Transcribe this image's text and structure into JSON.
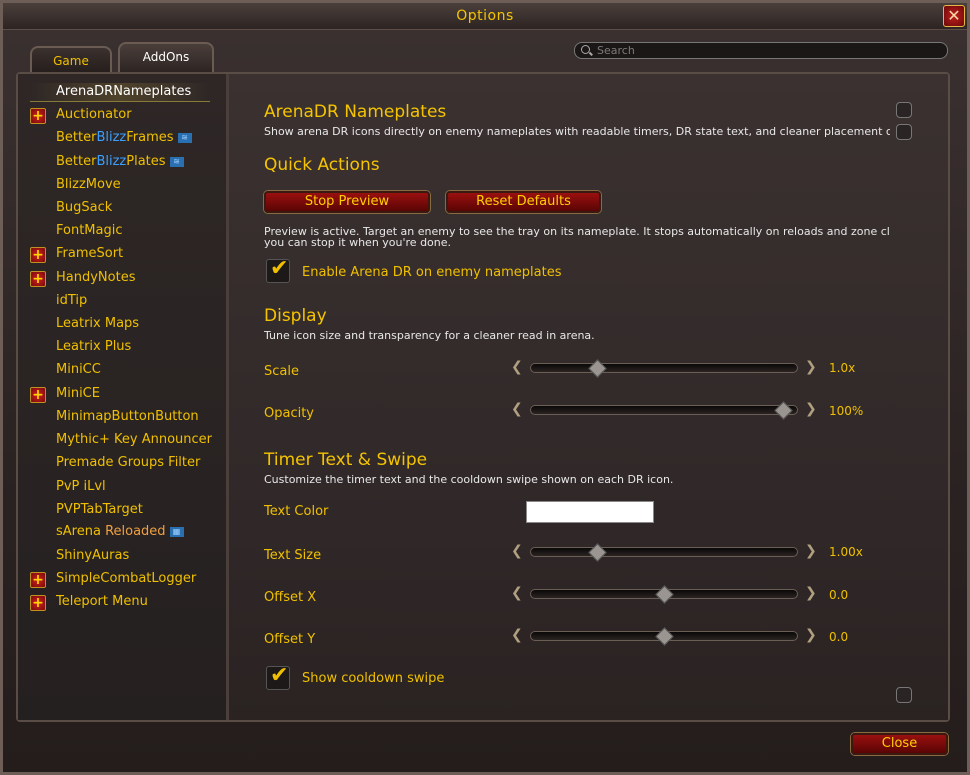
{
  "window": {
    "title": "Options",
    "close_glyph": "✕"
  },
  "tabs": [
    {
      "label": "Game"
    },
    {
      "label": "AddOns"
    }
  ],
  "search": {
    "placeholder": "Search"
  },
  "sidebar": {
    "items": [
      {
        "label": "ArenaDRNameplates",
        "selected": true
      },
      {
        "label": "Auctionator",
        "expandable": true
      },
      {
        "label_parts": [
          "Better",
          "Blizz",
          "Frames"
        ]
      },
      {
        "label_parts": [
          "Better",
          "Blizz",
          "Plates"
        ]
      },
      {
        "label": "BlizzMove"
      },
      {
        "label": "BugSack"
      },
      {
        "label": "FontMagic"
      },
      {
        "label": "FrameSort",
        "expandable": true
      },
      {
        "label": "HandyNotes",
        "expandable": true
      },
      {
        "label": "idTip"
      },
      {
        "label": "Leatrix Maps"
      },
      {
        "label": "Leatrix Plus"
      },
      {
        "label": "MiniCC"
      },
      {
        "label": "MiniCE",
        "expandable": true
      },
      {
        "label": "MinimapButtonButton"
      },
      {
        "label": "Mythic+ Key Announcer"
      },
      {
        "label": "Premade Groups Filter"
      },
      {
        "label": "PvP iLvl"
      },
      {
        "label": "PVPTabTarget"
      },
      {
        "label_parts": [
          "sArena",
          "Reloaded"
        ]
      },
      {
        "label": "ShinyAuras"
      },
      {
        "label": "SimpleCombatLogger",
        "expandable": true
      },
      {
        "label": "Teleport Menu",
        "expandable": true
      }
    ],
    "plus_glyph": "+"
  },
  "panel": {
    "title": "ArenaDR Nameplates",
    "description": "Show arena DR icons directly on enemy nameplates with readable timers, DR state text, and cleaner placement c",
    "quick_actions": {
      "heading": "Quick Actions",
      "stop_preview": "Stop Preview",
      "reset_defaults": "Reset Defaults",
      "note_line1": "Preview is active. Target an enemy to see the tray on its nameplate. It stops automatically on reloads and zone cl",
      "note_line2": "you can stop it when you're done.",
      "enable_label": "Enable Arena DR on enemy nameplates"
    },
    "display": {
      "heading": "Display",
      "description": "Tune icon size and transparency for a cleaner read in arena.",
      "scale": {
        "label": "Scale",
        "value": "1.0x",
        "fraction": 0.22
      },
      "opacity": {
        "label": "Opacity",
        "value": "100%",
        "fraction": 1.0
      }
    },
    "timer": {
      "heading": "Timer Text & Swipe",
      "description": "Customize the timer text and the cooldown swipe shown on each DR icon.",
      "text_color": {
        "label": "Text Color",
        "color": "#ffffff"
      },
      "text_size": {
        "label": "Text Size",
        "value": "1.00x",
        "fraction": 0.22
      },
      "offset_x": {
        "label": "Offset X",
        "value": "0.0",
        "fraction": 0.5
      },
      "offset_y": {
        "label": "Offset Y",
        "value": "0.0",
        "fraction": 0.5
      },
      "swipe_label": "Show cooldown swipe"
    },
    "check_glyph": "✔",
    "left_arrow": "❮",
    "right_arrow": "❯"
  },
  "footer": {
    "close_label": "Close"
  },
  "colors": {
    "gold": "#f0c000",
    "accent_blue": "#3aa0ff",
    "button_red": "#9a1010"
  }
}
